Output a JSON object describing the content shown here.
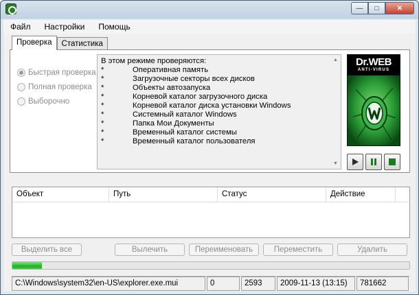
{
  "window": {
    "controls": {
      "minimize": "—",
      "maximize": "□",
      "close": "✕"
    }
  },
  "menu": [
    "Файл",
    "Настройки",
    "Помощь"
  ],
  "tabs": [
    {
      "label": "Проверка",
      "active": true
    },
    {
      "label": "Статистика",
      "active": false
    }
  ],
  "scan_modes": [
    {
      "label": "Быстрая проверка",
      "checked": true
    },
    {
      "label": "Полная проверка",
      "checked": false
    },
    {
      "label": "Выборочно",
      "checked": false
    }
  ],
  "info": {
    "heading": "В этом режиме проверяются:",
    "bullet": "*",
    "items": [
      "Оперативная память",
      "Загрузочные секторы всех дисков",
      "Объекты автозапуска",
      "Корневой каталог загрузочного диска",
      "Корневой каталог диска установки Windows",
      "Системный каталог Windows",
      "Папка Мои Документы",
      "Временный каталог системы",
      "Временный каталог пользователя"
    ]
  },
  "logo": {
    "brand": "Dr.WEB",
    "sub": "ANTI-VIRUS"
  },
  "scan_controls": [
    "play-icon",
    "pause-icon",
    "stop-icon"
  ],
  "results_table": {
    "columns": [
      "Объект",
      "Путь",
      "Статус",
      "Действие"
    ],
    "rows": []
  },
  "actions": [
    "Выделить все",
    "Вылечить",
    "Переименовать",
    "Переместить",
    "Удалить"
  ],
  "progress": {
    "fraction": 0.075,
    "color": "#20b220"
  },
  "status": {
    "file": "C:\\Windows\\system32\\en-US\\explorer.exe.mui",
    "threats": "0",
    "checked": "2593",
    "datetime": "2009-11-13 (13:15)",
    "records": "781662"
  }
}
